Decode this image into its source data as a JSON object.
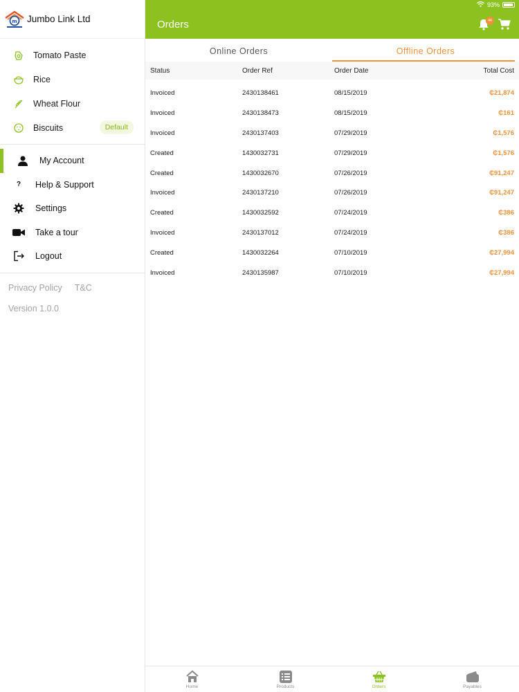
{
  "status_bar": {
    "wifi_icon": "wifi-icon",
    "battery_percent": "93%",
    "battery_level": 0.93
  },
  "sidebar": {
    "brand_name": "Jumbo Link Ltd",
    "companies": [
      {
        "label": "Tomato Paste",
        "icon": "tomato-paste-icon"
      },
      {
        "label": "Rice",
        "icon": "rice-icon"
      },
      {
        "label": "Wheat Flour",
        "icon": "wheat-flour-icon"
      },
      {
        "label": "Biscuits",
        "icon": "biscuits-icon",
        "badge": "Default"
      }
    ],
    "menu": [
      {
        "label": "My Account",
        "icon": "user-icon",
        "active": true
      },
      {
        "label": "Help & Support",
        "icon": "help-icon"
      },
      {
        "label": "Settings",
        "icon": "gear-icon"
      },
      {
        "label": "Take a tour",
        "icon": "video-icon"
      },
      {
        "label": "Logout",
        "icon": "logout-icon"
      }
    ],
    "links": {
      "privacy": "Privacy Policy",
      "terms": "T&C"
    },
    "version": "Version 1.0.0"
  },
  "header": {
    "title": "Orders",
    "notification_count": "44"
  },
  "tabs": {
    "online": "Online Orders",
    "offline": "Offline Orders",
    "active": "offline"
  },
  "table": {
    "columns": {
      "status": "Status",
      "ref": "Order Ref",
      "date": "Order Date",
      "cost": "Total Cost"
    },
    "rows": [
      {
        "status": "Invoiced",
        "ref": "2430138461",
        "date": "08/15/2019",
        "cost": "₵21,874"
      },
      {
        "status": "Invoiced",
        "ref": "2430138473",
        "date": "08/15/2019",
        "cost": "₵161"
      },
      {
        "status": "Invoiced",
        "ref": "2430137403",
        "date": "07/29/2019",
        "cost": "₵1,576"
      },
      {
        "status": "Created",
        "ref": "1430032731",
        "date": "07/29/2019",
        "cost": "₵1,576"
      },
      {
        "status": "Created",
        "ref": "1430032670",
        "date": "07/26/2019",
        "cost": "₵91,247"
      },
      {
        "status": "Invoiced",
        "ref": "2430137210",
        "date": "07/26/2019",
        "cost": "₵91,247"
      },
      {
        "status": "Created",
        "ref": "1430032592",
        "date": "07/24/2019",
        "cost": "₵386"
      },
      {
        "status": "Invoiced",
        "ref": "2430137012",
        "date": "07/24/2019",
        "cost": "₵386"
      },
      {
        "status": "Created",
        "ref": "1430032264",
        "date": "07/10/2019",
        "cost": "₵27,994"
      },
      {
        "status": "Invoiced",
        "ref": "2430135987",
        "date": "07/10/2019",
        "cost": "₵27,994"
      }
    ]
  },
  "tabbar": [
    {
      "label": "Home",
      "icon": "home-icon"
    },
    {
      "label": "Products",
      "icon": "products-list-icon"
    },
    {
      "label": "Orders",
      "icon": "basket-icon",
      "active": true
    },
    {
      "label": "Payables",
      "icon": "wallet-icon"
    }
  ],
  "colors": {
    "brand_green": "#8cc21f",
    "accent_orange": "#f0913a",
    "muted_gray": "#a3a3a3"
  }
}
